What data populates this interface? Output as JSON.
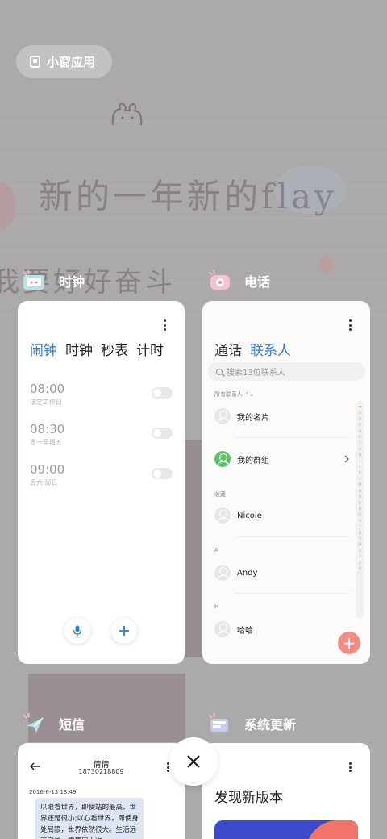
{
  "wallpaper": {
    "headline": "新的一年新的flay",
    "line2": "我要好好奋斗"
  },
  "small_window": {
    "label": "小窗应用",
    "icon": "small-window-icon"
  },
  "apps": {
    "clock": {
      "name": "时钟",
      "tabs": [
        "闹钟",
        "时钟",
        "秒表",
        "计时"
      ],
      "alarms": [
        {
          "time": "08:00",
          "desc": "法定工作日",
          "enabled": false
        },
        {
          "time": "08:30",
          "desc": "周一至周五",
          "enabled": false
        },
        {
          "time": "09:00",
          "desc": "周六 周日",
          "enabled": false
        }
      ]
    },
    "phone": {
      "name": "电话",
      "tabs": [
        "通话",
        "联系人"
      ],
      "search_placeholder": "搜索13位联系人",
      "all_contacts": "所有联系人 ⌃⌄",
      "my_card": "我的名片",
      "my_groups": "我的群组",
      "section_fav": "收藏",
      "contact_nicole": "Nicole",
      "section_a": "A",
      "contact_andy": "Andy",
      "section_h": "H",
      "contact_haha": "哈哈",
      "index": [
        "♥",
        "A",
        "B",
        "C",
        "D",
        "E",
        "F",
        "G",
        "H",
        "I",
        "J",
        "K",
        "L",
        "M",
        "N",
        "O",
        "P",
        "Q",
        "R",
        "S",
        "T",
        "U",
        "V",
        "W",
        "X",
        "Y",
        "Z",
        "#"
      ],
      "fab": "+"
    },
    "sms": {
      "name": "短信",
      "contact_name": "倩倩",
      "number": "18730218809",
      "date": "2016-6-13 13:49",
      "message": "以眼看世界，即使站的最高，世界还是很小;以心看世界，即使身处局限，世界依然很大。生活远不完美，需要用十次"
    },
    "update": {
      "name": "系统更新",
      "title": "发现新版本"
    }
  },
  "colors": {
    "accent": "#2f7be5",
    "fab": "#f28c86",
    "group_green": "#5fc26e"
  }
}
